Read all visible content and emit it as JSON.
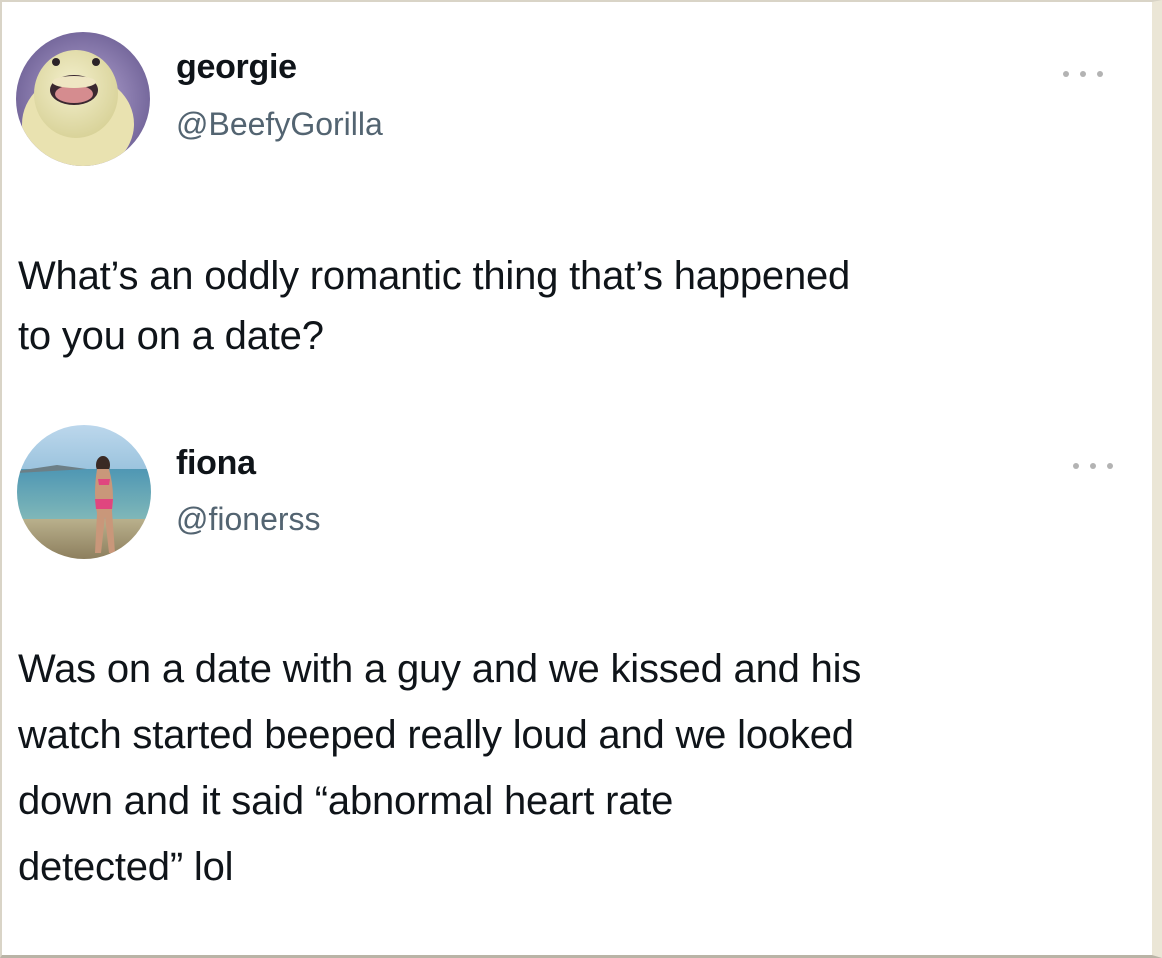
{
  "posts": [
    {
      "display_name": "georgie",
      "handle": "@BeefyGorilla",
      "avatar_icon": "duck-face-avatar",
      "lines": [
        "What’s an oddly romantic thing that’s happened",
        "to you on a date?"
      ]
    },
    {
      "display_name": "fiona",
      "handle": "@fionerss",
      "avatar_icon": "beach-photo-avatar",
      "lines": [
        "Was on a date with a guy and we kissed and his",
        "watch started beeped really loud and we looked",
        "down and it said “abnormal heart rate",
        "detected” lol"
      ]
    }
  ],
  "colors": {
    "text": "#0f1419",
    "handle": "#536471",
    "more_dots": "#b3b3b3"
  }
}
